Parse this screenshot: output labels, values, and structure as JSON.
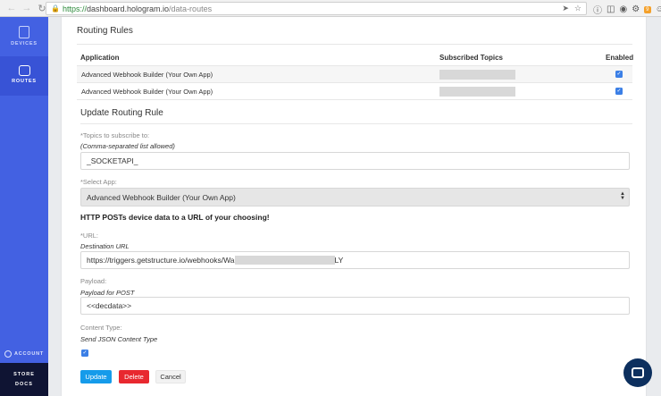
{
  "browser": {
    "url_secure": "https://",
    "url_host": "dashboard.hologram.io",
    "url_path": "/data-routes",
    "ext_badge": "9"
  },
  "sidebar": {
    "devices_label": "DEVICES",
    "routes_label": "ROUTES",
    "account_label": "ACCOUNT",
    "store_label": "STORE",
    "docs_label": "DOCS"
  },
  "routing_rules": {
    "title": "Routing Rules",
    "columns": [
      "Application",
      "Subscribed Topics",
      "Enabled"
    ],
    "rows": [
      {
        "application": "Advanced Webhook Builder (Your Own App)",
        "enabled": true
      },
      {
        "application": "Advanced Webhook Builder (Your Own App)",
        "enabled": true
      }
    ]
  },
  "update_form": {
    "title": "Update Routing Rule",
    "topics_label": "*Topics to subscribe to:",
    "topics_hint": "(Comma-separated list allowed)",
    "topics_value": "_SOCKETAPI_",
    "app_label": "*Select App:",
    "app_value": "Advanced Webhook Builder (Your Own App)",
    "app_description": "HTTP POSTs device data to a URL of your choosing!",
    "url_label": "*URL:",
    "url_hint": "Destination URL",
    "url_value_start": "https://triggers.getstructure.io/webhooks/Wa",
    "url_value_end": "LY",
    "payload_label": "Payload:",
    "payload_hint": "Payload for POST",
    "payload_value": "<<decdata>>",
    "content_type_label": "Content Type:",
    "content_type_hint": "Send JSON Content Type",
    "content_type_checked": true,
    "update_button": "Update",
    "delete_button": "Delete",
    "cancel_button": "Cancel"
  },
  "colors": {
    "sidebar": "#4361e2",
    "sidebar_active": "#3853d6",
    "primary": "#159bea",
    "danger": "#e8282f",
    "checkbox": "#3b7fe6"
  }
}
